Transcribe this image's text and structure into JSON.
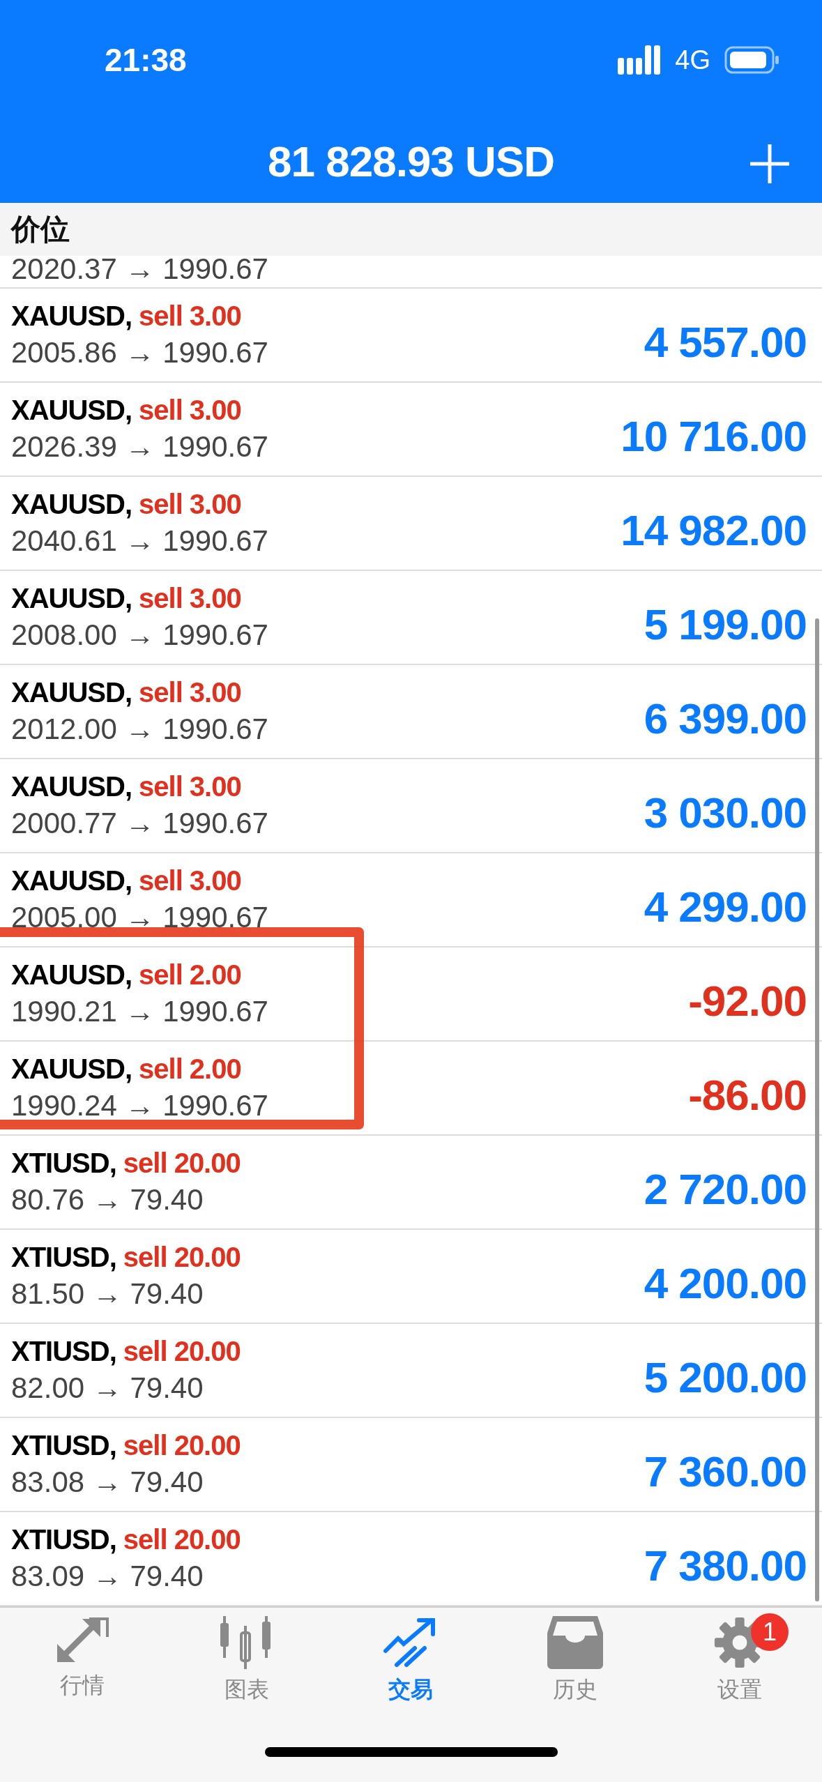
{
  "status_bar": {
    "time": "21:38",
    "network": "4G"
  },
  "header": {
    "balance": "81 828.93 USD"
  },
  "column_header": "价位",
  "partial_row": {
    "prices": "2020.37 → 1990.67"
  },
  "positions": [
    {
      "symbol": "XAUUSD,",
      "side": "sell 3.00",
      "prices": "2005.86 → 1990.67",
      "profit": "4 557.00",
      "color": "#0a7bff"
    },
    {
      "symbol": "XAUUSD,",
      "side": "sell 3.00",
      "prices": "2026.39 → 1990.67",
      "profit": "10 716.00",
      "color": "#0a7bff"
    },
    {
      "symbol": "XAUUSD,",
      "side": "sell 3.00",
      "prices": "2040.61 → 1990.67",
      "profit": "14 982.00",
      "color": "#0a7bff"
    },
    {
      "symbol": "XAUUSD,",
      "side": "sell 3.00",
      "prices": "2008.00 → 1990.67",
      "profit": "5 199.00",
      "color": "#0a7bff"
    },
    {
      "symbol": "XAUUSD,",
      "side": "sell 3.00",
      "prices": "2012.00 → 1990.67",
      "profit": "6 399.00",
      "color": "#0a7bff"
    },
    {
      "symbol": "XAUUSD,",
      "side": "sell 3.00",
      "prices": "2000.77 → 1990.67",
      "profit": "3 030.00",
      "color": "#0a7bff"
    },
    {
      "symbol": "XAUUSD,",
      "side": "sell 3.00",
      "prices": "2005.00 → 1990.67",
      "profit": "4 299.00",
      "color": "#0a7bff"
    },
    {
      "symbol": "XAUUSD,",
      "side": "sell 2.00",
      "prices": "1990.21 → 1990.67",
      "profit": "-92.00",
      "color": "#e0301e"
    },
    {
      "symbol": "XAUUSD,",
      "side": "sell 2.00",
      "prices": "1990.24 → 1990.67",
      "profit": "-86.00",
      "color": "#e0301e"
    },
    {
      "symbol": "XTIUSD,",
      "side": "sell 20.00",
      "prices": "80.76 → 79.40",
      "profit": "2 720.00",
      "color": "#0a7bff"
    },
    {
      "symbol": "XTIUSD,",
      "side": "sell 20.00",
      "prices": "81.50 → 79.40",
      "profit": "4 200.00",
      "color": "#0a7bff"
    },
    {
      "symbol": "XTIUSD,",
      "side": "sell 20.00",
      "prices": "82.00 → 79.40",
      "profit": "5 200.00",
      "color": "#0a7bff"
    },
    {
      "symbol": "XTIUSD,",
      "side": "sell 20.00",
      "prices": "83.08 → 79.40",
      "profit": "7 360.00",
      "color": "#0a7bff"
    },
    {
      "symbol": "XTIUSD,",
      "side": "sell 20.00",
      "prices": "83.09 → 79.40",
      "profit": "7 380.00",
      "color": "#0a7bff"
    }
  ],
  "tabs": [
    {
      "label": "行情",
      "selected": false,
      "kind": "quotes"
    },
    {
      "label": "图表",
      "selected": false,
      "kind": "chart"
    },
    {
      "label": "交易",
      "selected": true,
      "kind": "trade"
    },
    {
      "label": "历史",
      "selected": false,
      "kind": "history"
    },
    {
      "label": "设置",
      "selected": false,
      "kind": "settings",
      "badge": "1"
    }
  ]
}
